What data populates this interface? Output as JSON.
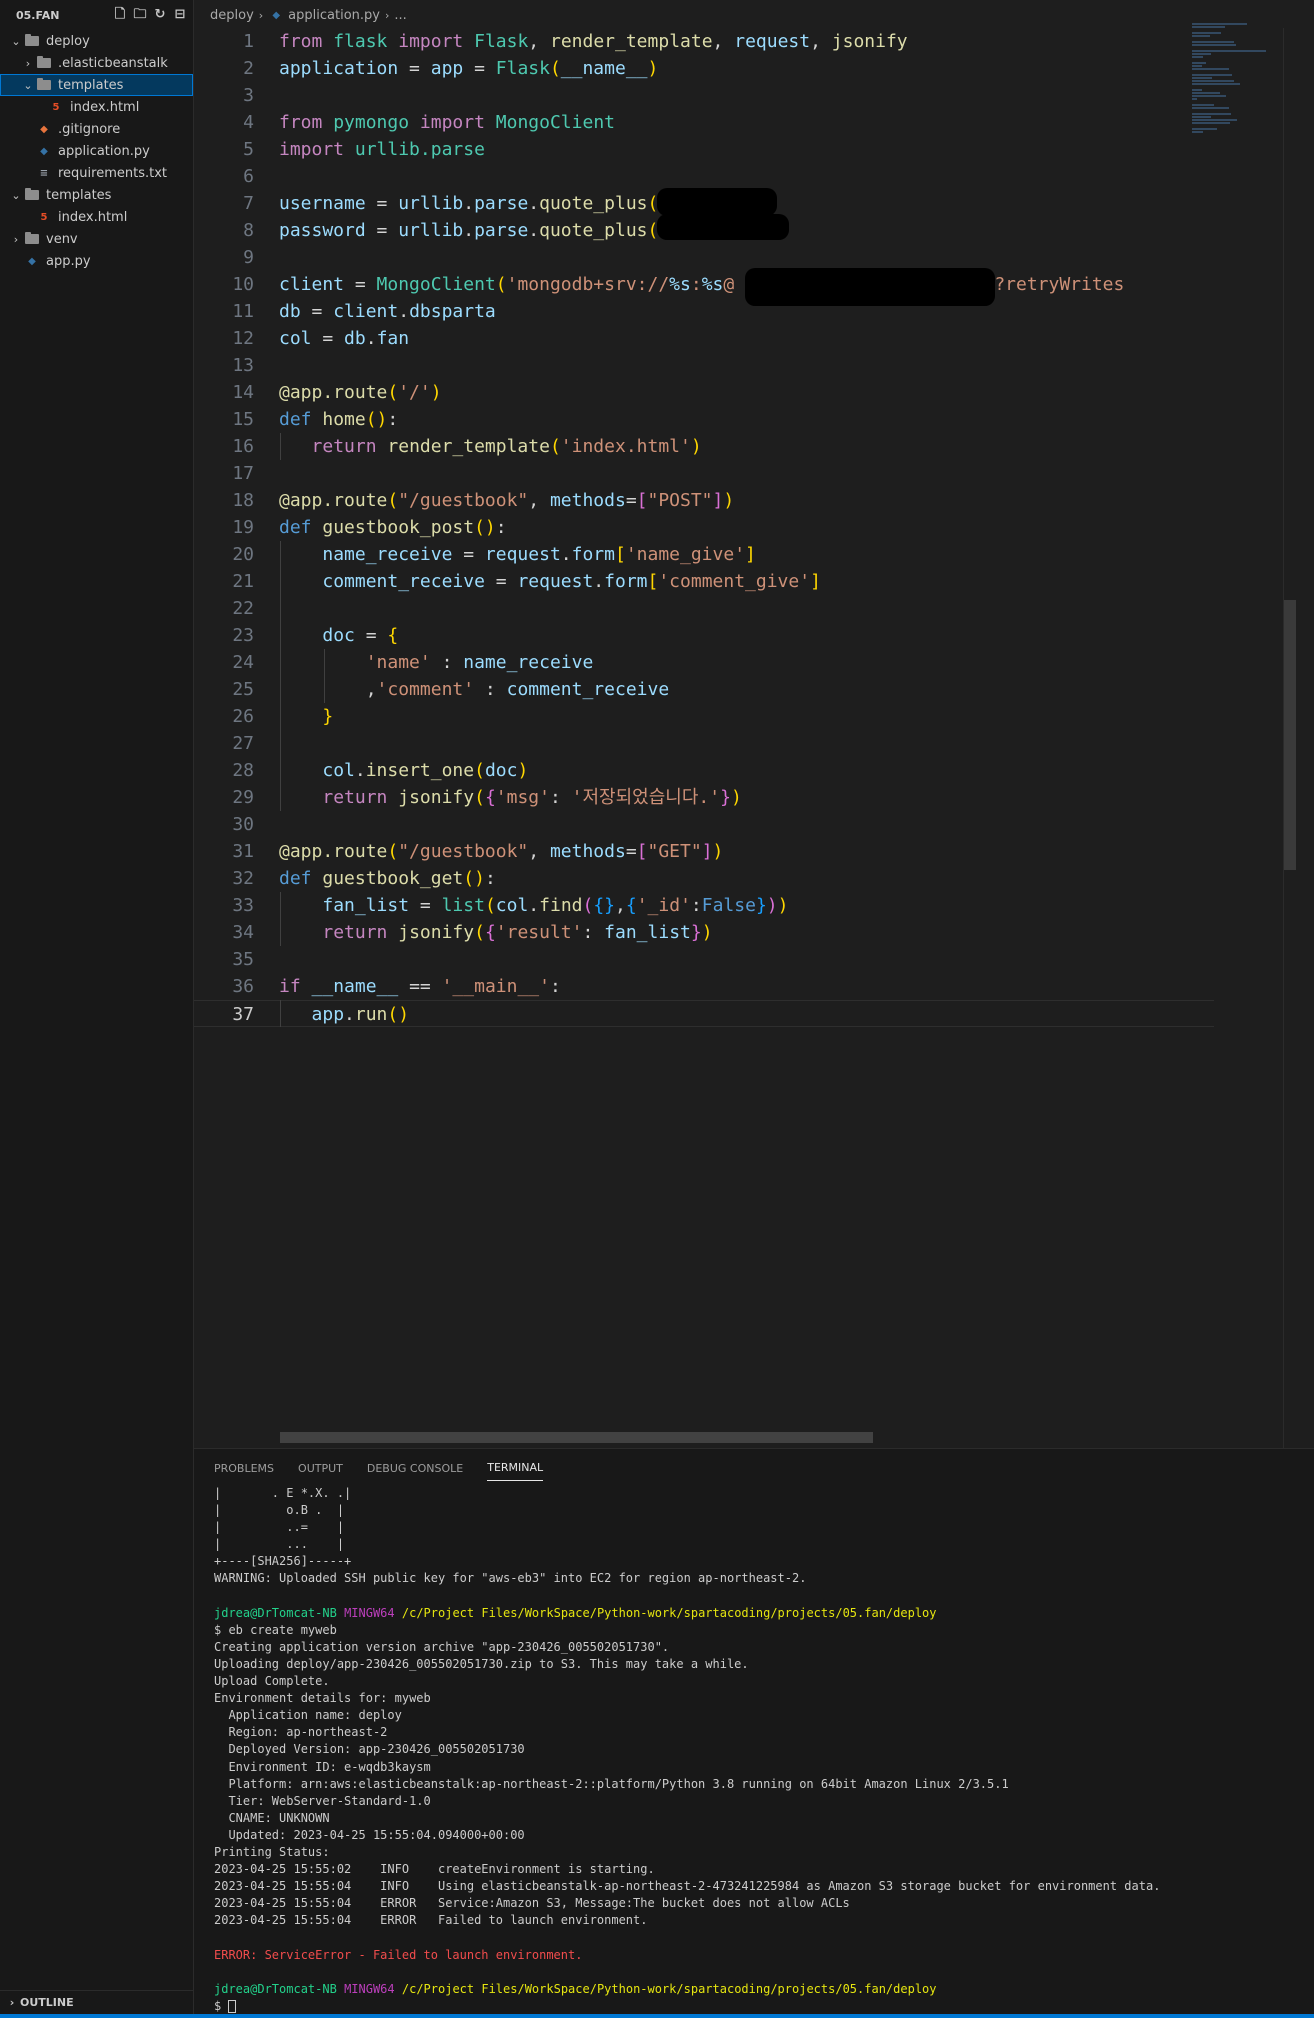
{
  "explorer": {
    "title": "05.FAN",
    "items": [
      {
        "label": "deploy",
        "type": "folder",
        "depth": 0,
        "expanded": true
      },
      {
        "label": ".elasticbeanstalk",
        "type": "folder",
        "depth": 1,
        "expanded": false
      },
      {
        "label": "templates",
        "type": "folder",
        "depth": 1,
        "expanded": true,
        "selected": true
      },
      {
        "label": "index.html",
        "type": "html",
        "depth": 2
      },
      {
        "label": ".gitignore",
        "type": "git",
        "depth": 1
      },
      {
        "label": "application.py",
        "type": "py",
        "depth": 1
      },
      {
        "label": "requirements.txt",
        "type": "txt",
        "depth": 1
      },
      {
        "label": "templates",
        "type": "folder",
        "depth": 0,
        "expanded": true
      },
      {
        "label": "index.html",
        "type": "html",
        "depth": 1
      },
      {
        "label": "venv",
        "type": "folder",
        "depth": 0,
        "expanded": false
      },
      {
        "label": "app.py",
        "type": "py",
        "depth": 0
      }
    ],
    "outline_label": "OUTLINE"
  },
  "breadcrumb": {
    "folder": "deploy",
    "file": "application.py",
    "tail": "..."
  },
  "editor": {
    "active_line": 37,
    "lines": [
      [
        [
          "kw",
          "from"
        ],
        [
          "op",
          " "
        ],
        [
          "cls",
          "flask"
        ],
        [
          "op",
          " "
        ],
        [
          "kw",
          "import"
        ],
        [
          "op",
          " "
        ],
        [
          "cls",
          "Flask"
        ],
        [
          "op",
          ", "
        ],
        [
          "fn",
          "render_template"
        ],
        [
          "op",
          ", "
        ],
        [
          "var",
          "request"
        ],
        [
          "op",
          ", "
        ],
        [
          "fn",
          "jsonify"
        ]
      ],
      [
        [
          "var",
          "application"
        ],
        [
          "op",
          " = "
        ],
        [
          "var",
          "app"
        ],
        [
          "op",
          " = "
        ],
        [
          "cls",
          "Flask"
        ],
        [
          "p1",
          "("
        ],
        [
          "var",
          "__name__"
        ],
        [
          "p1",
          ")"
        ]
      ],
      [],
      [
        [
          "kw",
          "from"
        ],
        [
          "op",
          " "
        ],
        [
          "cls",
          "pymongo"
        ],
        [
          "op",
          " "
        ],
        [
          "kw",
          "import"
        ],
        [
          "op",
          " "
        ],
        [
          "cls",
          "MongoClient"
        ]
      ],
      [
        [
          "kw",
          "import"
        ],
        [
          "op",
          " "
        ],
        [
          "cls",
          "urllib.parse"
        ]
      ],
      [],
      [
        [
          "var",
          "username"
        ],
        [
          "op",
          " = "
        ],
        [
          "var",
          "urllib"
        ],
        [
          "op",
          "."
        ],
        [
          "var",
          "parse"
        ],
        [
          "op",
          "."
        ],
        [
          "fn",
          "quote_plus"
        ],
        [
          "p1",
          "("
        ],
        [
          "str",
          "'"
        ],
        [
          "str",
          "      "
        ],
        [
          "str",
          "'"
        ],
        [
          "p1",
          ")"
        ]
      ],
      [
        [
          "var",
          "password"
        ],
        [
          "op",
          " = "
        ],
        [
          "var",
          "urllib"
        ],
        [
          "op",
          "."
        ],
        [
          "var",
          "parse"
        ],
        [
          "op",
          "."
        ],
        [
          "fn",
          "quote_plus"
        ],
        [
          "p1",
          "("
        ],
        [
          "str",
          "'"
        ],
        [
          "str",
          "        "
        ],
        [
          "str",
          "'"
        ],
        [
          "p1",
          ")"
        ]
      ],
      [],
      [
        [
          "var",
          "client"
        ],
        [
          "op",
          " = "
        ],
        [
          "cls",
          "MongoClient"
        ],
        [
          "p1",
          "("
        ],
        [
          "str",
          "'mongodb+srv://"
        ],
        [
          "var",
          "%s"
        ],
        [
          "str",
          ":"
        ],
        [
          "var",
          "%s"
        ],
        [
          "str",
          "@                  b.net/?retryWrites"
        ]
      ],
      [
        [
          "var",
          "db"
        ],
        [
          "op",
          " = "
        ],
        [
          "var",
          "client"
        ],
        [
          "op",
          "."
        ],
        [
          "var",
          "dbsparta"
        ]
      ],
      [
        [
          "var",
          "col"
        ],
        [
          "op",
          " = "
        ],
        [
          "var",
          "db"
        ],
        [
          "op",
          "."
        ],
        [
          "var",
          "fan"
        ]
      ],
      [],
      [
        [
          "dec",
          "@app.route"
        ],
        [
          "p1",
          "("
        ],
        [
          "str",
          "'/'"
        ],
        [
          "p1",
          ")"
        ]
      ],
      [
        [
          "def",
          "def"
        ],
        [
          "op",
          " "
        ],
        [
          "fn",
          "home"
        ],
        [
          "p1",
          "()"
        ],
        [
          "op",
          ":"
        ]
      ],
      [
        [
          "op",
          "   "
        ],
        [
          "kw",
          "return"
        ],
        [
          "op",
          " "
        ],
        [
          "fn",
          "render_template"
        ],
        [
          "p1",
          "("
        ],
        [
          "str",
          "'index.html'"
        ],
        [
          "p1",
          ")"
        ]
      ],
      [],
      [
        [
          "dec",
          "@app.route"
        ],
        [
          "p1",
          "("
        ],
        [
          "str",
          "\"/guestbook\""
        ],
        [
          "op",
          ", "
        ],
        [
          "var",
          "methods"
        ],
        [
          "op",
          "="
        ],
        [
          "p2",
          "["
        ],
        [
          "str",
          "\"POST\""
        ],
        [
          "p2",
          "]"
        ],
        [
          "p1",
          ")"
        ]
      ],
      [
        [
          "def",
          "def"
        ],
        [
          "op",
          " "
        ],
        [
          "fn",
          "guestbook_post"
        ],
        [
          "p1",
          "()"
        ],
        [
          "op",
          ":"
        ]
      ],
      [
        [
          "op",
          "    "
        ],
        [
          "var",
          "name_receive"
        ],
        [
          "op",
          " = "
        ],
        [
          "var",
          "request"
        ],
        [
          "op",
          "."
        ],
        [
          "var",
          "form"
        ],
        [
          "p1",
          "["
        ],
        [
          "str",
          "'name_give'"
        ],
        [
          "p1",
          "]"
        ]
      ],
      [
        [
          "op",
          "    "
        ],
        [
          "var",
          "comment_receive"
        ],
        [
          "op",
          " = "
        ],
        [
          "var",
          "request"
        ],
        [
          "op",
          "."
        ],
        [
          "var",
          "form"
        ],
        [
          "p1",
          "["
        ],
        [
          "str",
          "'comment_give'"
        ],
        [
          "p1",
          "]"
        ]
      ],
      [],
      [
        [
          "op",
          "    "
        ],
        [
          "var",
          "doc"
        ],
        [
          "op",
          " = "
        ],
        [
          "p1",
          "{"
        ]
      ],
      [
        [
          "op",
          "        "
        ],
        [
          "str",
          "'name'"
        ],
        [
          "op",
          " : "
        ],
        [
          "var",
          "name_receive"
        ]
      ],
      [
        [
          "op",
          "        ,"
        ],
        [
          "str",
          "'comment'"
        ],
        [
          "op",
          " : "
        ],
        [
          "var",
          "comment_receive"
        ]
      ],
      [
        [
          "op",
          "    "
        ],
        [
          "p1",
          "}"
        ]
      ],
      [],
      [
        [
          "op",
          "    "
        ],
        [
          "var",
          "col"
        ],
        [
          "op",
          "."
        ],
        [
          "fn",
          "insert_one"
        ],
        [
          "p1",
          "("
        ],
        [
          "var",
          "doc"
        ],
        [
          "p1",
          ")"
        ]
      ],
      [
        [
          "op",
          "    "
        ],
        [
          "kw",
          "return"
        ],
        [
          "op",
          " "
        ],
        [
          "fn",
          "jsonify"
        ],
        [
          "p1",
          "("
        ],
        [
          "p2",
          "{"
        ],
        [
          "str",
          "'msg'"
        ],
        [
          "op",
          ": "
        ],
        [
          "str",
          "'저장되었습니다.'"
        ],
        [
          "p2",
          "}"
        ],
        [
          "p1",
          ")"
        ]
      ],
      [],
      [
        [
          "dec",
          "@app.route"
        ],
        [
          "p1",
          "("
        ],
        [
          "str",
          "\"/guestbook\""
        ],
        [
          "op",
          ", "
        ],
        [
          "var",
          "methods"
        ],
        [
          "op",
          "="
        ],
        [
          "p2",
          "["
        ],
        [
          "str",
          "\"GET\""
        ],
        [
          "p2",
          "]"
        ],
        [
          "p1",
          ")"
        ]
      ],
      [
        [
          "def",
          "def"
        ],
        [
          "op",
          " "
        ],
        [
          "fn",
          "guestbook_get"
        ],
        [
          "p1",
          "()"
        ],
        [
          "op",
          ":"
        ]
      ],
      [
        [
          "op",
          "    "
        ],
        [
          "var",
          "fan_list"
        ],
        [
          "op",
          " = "
        ],
        [
          "cls",
          "list"
        ],
        [
          "p1",
          "("
        ],
        [
          "var",
          "col"
        ],
        [
          "op",
          "."
        ],
        [
          "fn",
          "find"
        ],
        [
          "p2",
          "("
        ],
        [
          "p3",
          "{}"
        ],
        [
          "op",
          ","
        ],
        [
          "p3",
          "{"
        ],
        [
          "str",
          "'_id'"
        ],
        [
          "op",
          ":"
        ],
        [
          "bool",
          "False"
        ],
        [
          "p3",
          "}"
        ],
        [
          "p2",
          ")"
        ],
        [
          "p1",
          ")"
        ]
      ],
      [
        [
          "op",
          "    "
        ],
        [
          "kw",
          "return"
        ],
        [
          "op",
          " "
        ],
        [
          "fn",
          "jsonify"
        ],
        [
          "p1",
          "("
        ],
        [
          "p2",
          "{"
        ],
        [
          "str",
          "'result'"
        ],
        [
          "op",
          ": "
        ],
        [
          "var",
          "fan_list"
        ],
        [
          "p2",
          "}"
        ],
        [
          "p1",
          ")"
        ]
      ],
      [],
      [
        [
          "kw",
          "if"
        ],
        [
          "op",
          " "
        ],
        [
          "var",
          "__name__"
        ],
        [
          "op",
          " == "
        ],
        [
          "str",
          "'__main__'"
        ],
        [
          "op",
          ":"
        ]
      ],
      [
        [
          "op",
          "   "
        ],
        [
          "var",
          "app"
        ],
        [
          "op",
          "."
        ],
        [
          "fn",
          "run"
        ],
        [
          "p1",
          "()"
        ]
      ]
    ]
  },
  "panel": {
    "tabs": [
      {
        "label": "PROBLEMS",
        "active": false
      },
      {
        "label": "OUTPUT",
        "active": false
      },
      {
        "label": "DEBUG CONSOLE",
        "active": false
      },
      {
        "label": "TERMINAL",
        "active": true
      }
    ],
    "terminal": [
      [
        [
          "n",
          "|       . E *.X. .|"
        ]
      ],
      [
        [
          "n",
          "|         o.B .  |"
        ]
      ],
      [
        [
          "n",
          "|         ..=    |"
        ]
      ],
      [
        [
          "n",
          "|         ...    |"
        ]
      ],
      [
        [
          "n",
          "+----[SHA256]-----+"
        ]
      ],
      [
        [
          "n",
          "WARNING: Uploaded SSH public key for \"aws-eb3\" into EC2 for region ap-northeast-2."
        ]
      ],
      [],
      [
        [
          "user",
          "jdrea@DrTomcat-NB"
        ],
        [
          "n",
          " "
        ],
        [
          "mingw",
          "MINGW64"
        ],
        [
          "n",
          " "
        ],
        [
          "path",
          "/c/Project Files/WorkSpace/Python-work/spartacoding/projects/05.fan/deploy"
        ]
      ],
      [
        [
          "n",
          "$ eb create myweb"
        ]
      ],
      [
        [
          "n",
          "Creating application version archive \"app-230426_005502051730\"."
        ]
      ],
      [
        [
          "n",
          "Uploading deploy/app-230426_005502051730.zip to S3. This may take a while."
        ]
      ],
      [
        [
          "n",
          "Upload Complete."
        ]
      ],
      [
        [
          "n",
          "Environment details for: myweb"
        ]
      ],
      [
        [
          "n",
          "  Application name: deploy"
        ]
      ],
      [
        [
          "n",
          "  Region: ap-northeast-2"
        ]
      ],
      [
        [
          "n",
          "  Deployed Version: app-230426_005502051730"
        ]
      ],
      [
        [
          "n",
          "  Environment ID: e-wqdb3kaysm"
        ]
      ],
      [
        [
          "n",
          "  Platform: arn:aws:elasticbeanstalk:ap-northeast-2::platform/Python 3.8 running on 64bit Amazon Linux 2/3.5.1"
        ]
      ],
      [
        [
          "n",
          "  Tier: WebServer-Standard-1.0"
        ]
      ],
      [
        [
          "n",
          "  CNAME: UNKNOWN"
        ]
      ],
      [
        [
          "n",
          "  Updated: 2023-04-25 15:55:04.094000+00:00"
        ]
      ],
      [
        [
          "n",
          "Printing Status:"
        ]
      ],
      [
        [
          "n",
          "2023-04-25 15:55:02    INFO    createEnvironment is starting."
        ]
      ],
      [
        [
          "n",
          "2023-04-25 15:55:04    INFO    Using elasticbeanstalk-ap-northeast-2-473241225984 as Amazon S3 storage bucket for environment data."
        ]
      ],
      [
        [
          "n",
          "2023-04-25 15:55:04    ERROR   Service:Amazon S3, Message:The bucket does not allow ACLs"
        ]
      ],
      [
        [
          "n",
          "2023-04-25 15:55:04    ERROR   Failed to launch environment."
        ]
      ],
      [],
      [
        [
          "err",
          "ERROR: ServiceError - Failed to launch environment."
        ]
      ],
      [],
      [
        [
          "user",
          "jdrea@DrTomcat-NB"
        ],
        [
          "n",
          " "
        ],
        [
          "mingw",
          "MINGW64"
        ],
        [
          "n",
          " "
        ],
        [
          "path",
          "/c/Project Files/WorkSpace/Python-work/spartacoding/projects/05.fan/deploy"
        ]
      ],
      [
        [
          "n",
          "$ "
        ],
        [
          "cursor",
          ""
        ]
      ]
    ]
  }
}
